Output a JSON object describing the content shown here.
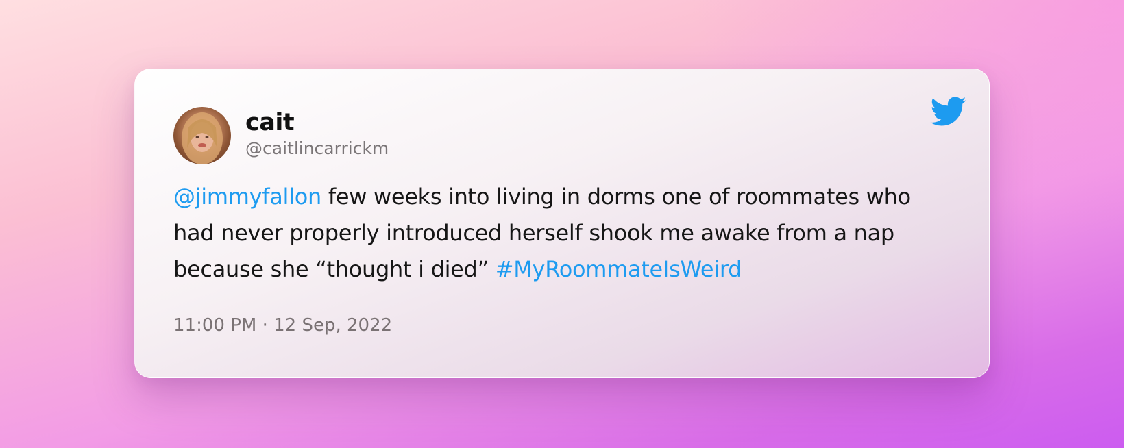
{
  "tweet": {
    "author_name": "cait",
    "author_handle": "@caitlincarrickm",
    "mention": "@jimmyfallon",
    "line1_text": " few weeks into living in dorms one of roommates who",
    "line2_text": "had never properly introduced herself shook me awake from a nap",
    "line3_text": "because she “thought i died” ",
    "hashtag": "#MyRoommateIsWeird",
    "timestamp": "11:00 PM · 12 Sep, 2022"
  },
  "icons": {
    "platform": "twitter-bird-icon",
    "avatar": "user-avatar"
  },
  "colors": {
    "link": "#1d9bf0",
    "twitter_blue": "#1d9bf0",
    "text": "#161616",
    "muted": "#7a7577"
  }
}
